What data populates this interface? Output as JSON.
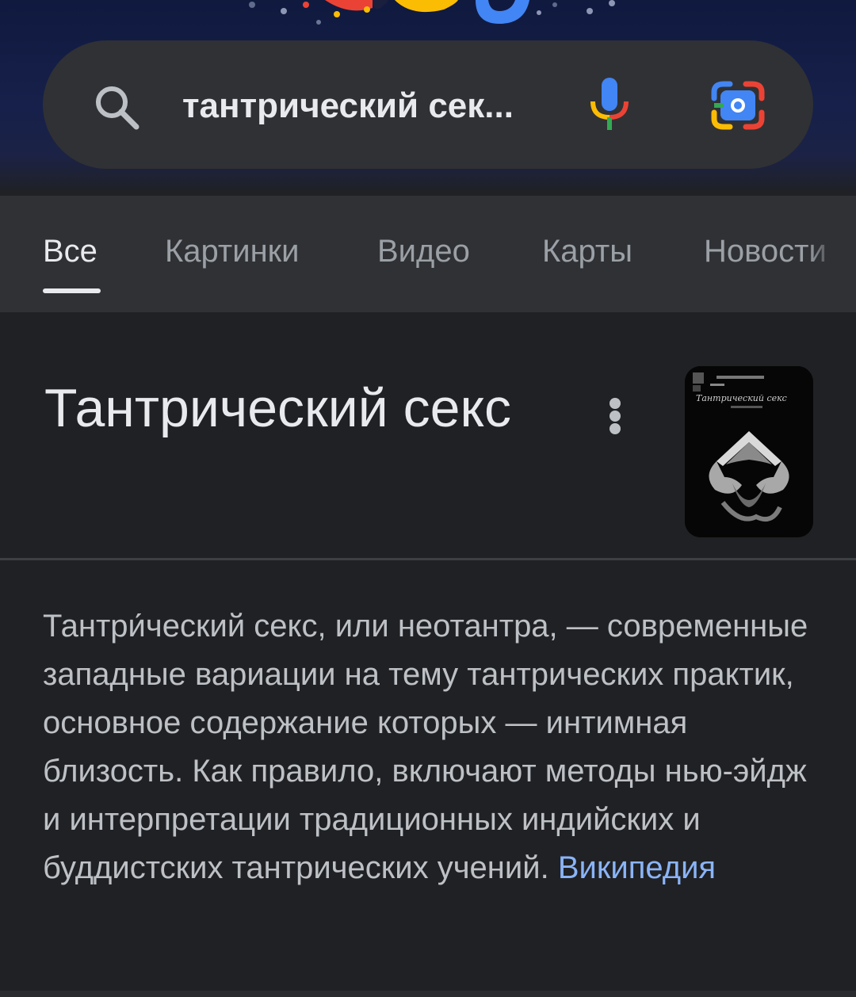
{
  "search": {
    "query": "тантрический сек..."
  },
  "tabs": [
    {
      "label": "Все",
      "active": true
    },
    {
      "label": "Картинки",
      "active": false
    },
    {
      "label": "Видео",
      "active": false
    },
    {
      "label": "Карты",
      "active": false
    },
    {
      "label": "Новости",
      "active": false
    }
  ],
  "knowledge_panel": {
    "title": "Тантрический секс",
    "description": "Тантри́ческий секс, или неотантра, — современные западные вариации на тему тантрических практик, основное содержание которых — интимная близость. Как правило, включают методы нью-эйдж и интерпретации традиционных индийских и буддистских тантрических учений.",
    "source_link": "Википедия",
    "thumbnail_caption": "Тантрический секс"
  },
  "icons": {
    "search": "search-icon",
    "mic": "mic-icon",
    "lens": "google-lens-icon",
    "more": "more-vert-icon"
  },
  "colors": {
    "background": "#202124",
    "surface": "#303134",
    "link": "#8ab4f8",
    "text": "#e8eaed",
    "muted": "#9aa0a6"
  }
}
